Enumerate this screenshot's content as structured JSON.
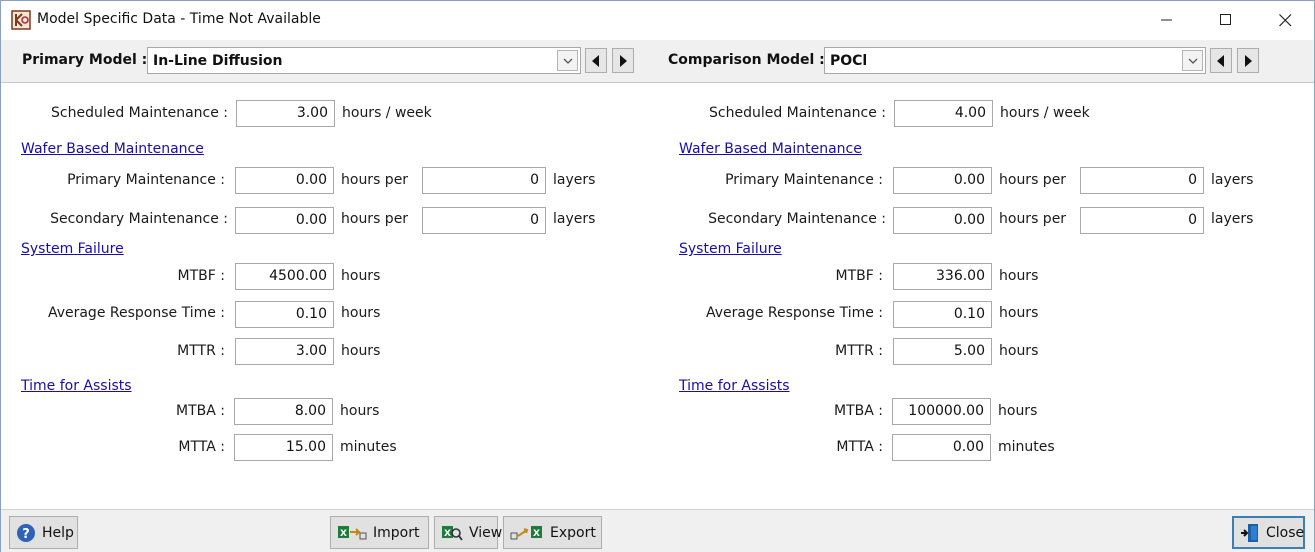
{
  "window": {
    "title": "Model Specific Data - Time Not Available",
    "minimize_icon": "minimize-icon",
    "maximize_icon": "maximize-icon",
    "close_icon": "close-icon"
  },
  "primary": {
    "label": "Primary Model :",
    "selected": "In-Line Diffusion",
    "scheduled_label": "Scheduled Maintenance :",
    "scheduled_value": "3.00",
    "scheduled_unit": "hours / week",
    "wafer_link": "Wafer Based Maintenance",
    "primary_maint_label": "Primary Maintenance :",
    "primary_maint_hours": "0.00",
    "primary_maint_unit": "hours per",
    "primary_maint_layers": "0",
    "primary_maint_layers_unit": "layers",
    "secondary_maint_label": "Secondary Maintenance :",
    "secondary_maint_hours": "0.00",
    "secondary_maint_unit": "hours per",
    "secondary_maint_layers": "0",
    "secondary_maint_layers_unit": "layers",
    "system_failure_link": "System Failure",
    "mtbf_label": "MTBF :",
    "mtbf_value": "4500.00",
    "mtbf_unit": "hours",
    "art_label": "Average Response Time :",
    "art_value": "0.10",
    "art_unit": "hours",
    "mttr_label": "MTTR :",
    "mttr_value": "3.00",
    "mttr_unit": "hours",
    "assists_link": "Time for Assists",
    "mtba_label": "MTBA :",
    "mtba_value": "8.00",
    "mtba_unit": "hours",
    "mtta_label": "MTTA :",
    "mtta_value": "15.00",
    "mtta_unit": "minutes"
  },
  "comparison": {
    "label": "Comparison Model :",
    "selected": "POCl",
    "scheduled_label": "Scheduled Maintenance :",
    "scheduled_value": "4.00",
    "scheduled_unit": "hours / week",
    "wafer_link": "Wafer Based Maintenance",
    "primary_maint_label": "Primary Maintenance :",
    "primary_maint_hours": "0.00",
    "primary_maint_unit": "hours per",
    "primary_maint_layers": "0",
    "primary_maint_layers_unit": "layers",
    "secondary_maint_label": "Secondary Maintenance :",
    "secondary_maint_hours": "0.00",
    "secondary_maint_unit": "hours per",
    "secondary_maint_layers": "0",
    "secondary_maint_layers_unit": "layers",
    "system_failure_link": "System Failure",
    "mtbf_label": "MTBF :",
    "mtbf_value": "336.00",
    "mtbf_unit": "hours",
    "art_label": "Average Response Time :",
    "art_value": "0.10",
    "art_unit": "hours",
    "mttr_label": "MTTR :",
    "mttr_value": "5.00",
    "mttr_unit": "hours",
    "assists_link": "Time for Assists",
    "mtba_label": "MTBA :",
    "mtba_value": "100000.00",
    "mtba_unit": "hours",
    "mtta_label": "MTTA :",
    "mtta_value": "0.00",
    "mtta_unit": "minutes"
  },
  "buttons": {
    "help": "Help",
    "import": "Import",
    "view": "View",
    "export": "Export",
    "close": "Close"
  },
  "colors": {
    "link": "#1a0dab",
    "bar_background": "#f0f0f0",
    "close_border": "#3c7fb1"
  }
}
